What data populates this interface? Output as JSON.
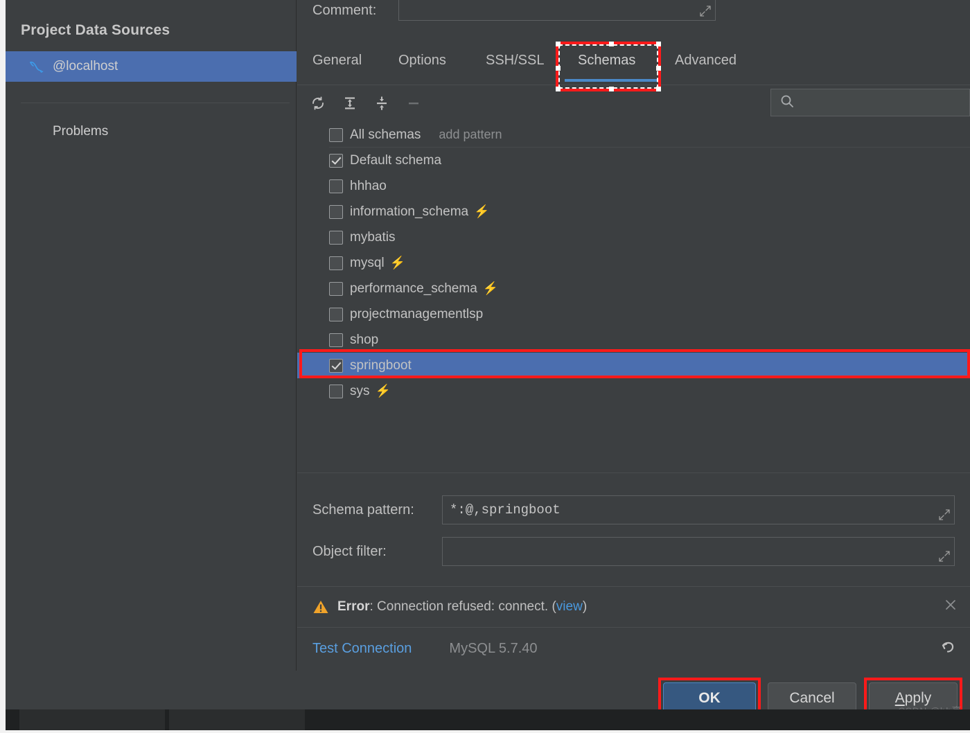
{
  "sidebar": {
    "title": "Project Data Sources",
    "items": [
      {
        "label": "@localhost",
        "icon": "mysql-dolphin-icon",
        "selected": true
      },
      {
        "label": "Problems",
        "icon": "none",
        "selected": false
      }
    ],
    "help_label": "?"
  },
  "comment": {
    "label": "Comment:",
    "value": "",
    "expand_icon": "expand-editor-icon"
  },
  "tabs": {
    "items": [
      {
        "label": "General",
        "active": false
      },
      {
        "label": "Options",
        "active": false
      },
      {
        "label": "SSH/SSL",
        "active": false
      },
      {
        "label": "Schemas",
        "active": true
      },
      {
        "label": "Advanced",
        "active": false
      }
    ]
  },
  "toolbar": {
    "refresh_icon": "refresh-icon",
    "expand_all_icon": "expand-all-icon",
    "collapse_all_icon": "collapse-all-icon",
    "remove_icon": "minus-icon",
    "search_placeholder": "",
    "search_value": "",
    "search_icon": "search-icon"
  },
  "schema_list": {
    "rows": [
      {
        "label": "All schemas",
        "checked": false,
        "bolt": false,
        "selected": false,
        "extra": "add pattern",
        "separator": true
      },
      {
        "label": "Default schema",
        "checked": true,
        "bolt": false,
        "selected": false,
        "extra": "",
        "separator": false
      },
      {
        "label": "hhhao",
        "checked": false,
        "bolt": false,
        "selected": false,
        "extra": "",
        "separator": false
      },
      {
        "label": "information_schema",
        "checked": false,
        "bolt": true,
        "selected": false,
        "extra": "",
        "separator": false
      },
      {
        "label": "mybatis",
        "checked": false,
        "bolt": false,
        "selected": false,
        "extra": "",
        "separator": false
      },
      {
        "label": "mysql",
        "checked": false,
        "bolt": true,
        "selected": false,
        "extra": "",
        "separator": false
      },
      {
        "label": "performance_schema",
        "checked": false,
        "bolt": true,
        "selected": false,
        "extra": "",
        "separator": false
      },
      {
        "label": "projectmanagementlsp",
        "checked": false,
        "bolt": false,
        "selected": false,
        "extra": "",
        "separator": false
      },
      {
        "label": "shop",
        "checked": false,
        "bolt": false,
        "selected": false,
        "extra": "",
        "separator": false
      },
      {
        "label": "springboot",
        "checked": true,
        "bolt": false,
        "selected": true,
        "extra": "",
        "separator": false
      },
      {
        "label": "sys",
        "checked": false,
        "bolt": true,
        "selected": false,
        "extra": "",
        "separator": false
      }
    ]
  },
  "form": {
    "schema_pattern_label": "Schema pattern:",
    "schema_pattern_value": "*:@,springboot",
    "object_filter_label": "Object filter:",
    "object_filter_value": ""
  },
  "error": {
    "icon": "warning-triangle-icon",
    "prefix": "Error",
    "message": ": Connection refused: connect. (",
    "link": "view",
    "suffix": ")",
    "close_icon": "close-icon"
  },
  "footer": {
    "test_connection": "Test Connection",
    "db_version": "MySQL 5.7.40",
    "revert_icon": "revert-icon"
  },
  "buttons": {
    "ok": "OK",
    "cancel": "Cancel",
    "apply_underlined": "A",
    "apply_rest": "pply"
  },
  "annotations": {
    "schemas_tab": "red-highlight-box",
    "springboot_row": "red-highlight-box",
    "ok_button": "red-highlight-box",
    "apply_button": "red-highlight-box"
  },
  "watermark": "CSDN @hh豪",
  "colors": {
    "window_bg": "#3c3f41",
    "selection_blue": "#4b6eaf",
    "accent_blue": "#4a88c7",
    "link_blue": "#5a9fe0",
    "bolt_orange": "#f0a32a",
    "annotation_red": "#ff1a1a",
    "primary_button_bg": "#365880"
  }
}
